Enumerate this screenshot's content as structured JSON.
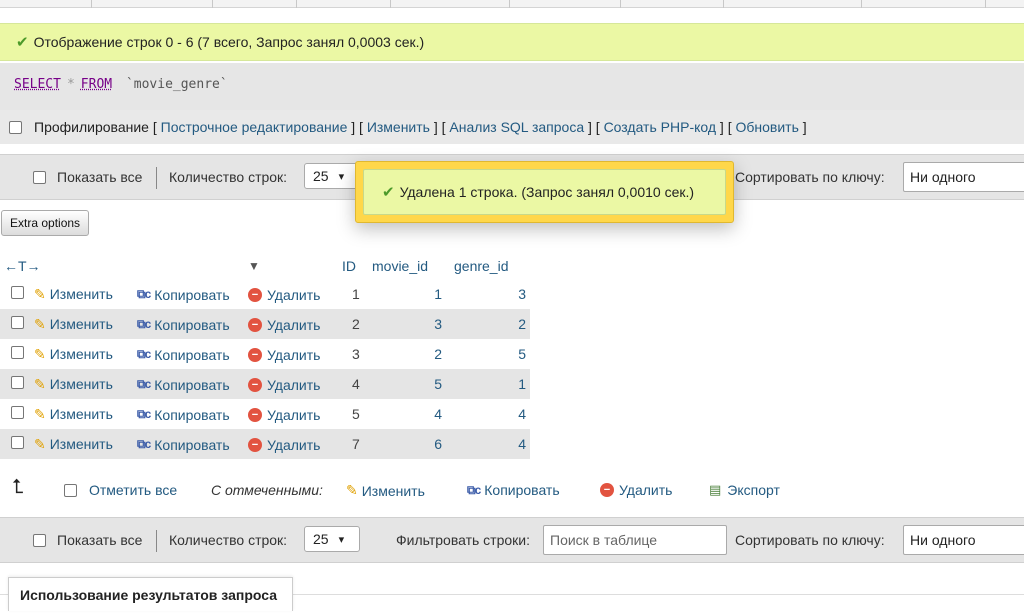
{
  "result_message": "Отображение строк 0 - 6 (7 всего, Запрос занял 0,0003 сек.)",
  "sql": {
    "select": "SELECT",
    "star": "*",
    "from": "FROM",
    "table": "`movie_genre`"
  },
  "profiling": {
    "label": "Профилирование",
    "links": [
      "Построчное редактирование",
      "Изменить",
      "Анализ SQL запроса",
      "Создать PHP-код",
      "Обновить"
    ]
  },
  "nav": {
    "show_all": "Показать все",
    "rows_label": "Количество строк:",
    "rows_value": "25",
    "filter_label": "Фильтровать строки:",
    "filter_placeholder": "Поиск в таблице",
    "sort_label": "Сортировать по ключу:",
    "sort_value": "Ни одного"
  },
  "toast": "Удалена 1 строка. (Запрос занял 0,0010 сек.)",
  "extra_options": "Extra options",
  "columns": [
    "ID",
    "movie_id",
    "genre_id"
  ],
  "actions": {
    "edit": "Изменить",
    "copy": "Копировать",
    "delete": "Удалить"
  },
  "rows": [
    {
      "id": "1",
      "movie_id": "1",
      "genre_id": "3"
    },
    {
      "id": "2",
      "movie_id": "3",
      "genre_id": "2"
    },
    {
      "id": "3",
      "movie_id": "2",
      "genre_id": "5"
    },
    {
      "id": "4",
      "movie_id": "5",
      "genre_id": "1"
    },
    {
      "id": "5",
      "movie_id": "4",
      "genre_id": "4"
    },
    {
      "id": "7",
      "movie_id": "6",
      "genre_id": "4"
    }
  ],
  "bulk": {
    "check_all": "Отметить все",
    "with_selected": "С отмеченными:",
    "edit": "Изменить",
    "copy": "Копировать",
    "delete": "Удалить",
    "export": "Экспорт"
  },
  "query_results_ops": "Использование результатов запроса",
  "colors": {
    "success_bg": "#ebf8a4",
    "toast_border": "#ffd74a",
    "link": "#235a81",
    "row_alt": "#e5e5e5"
  }
}
